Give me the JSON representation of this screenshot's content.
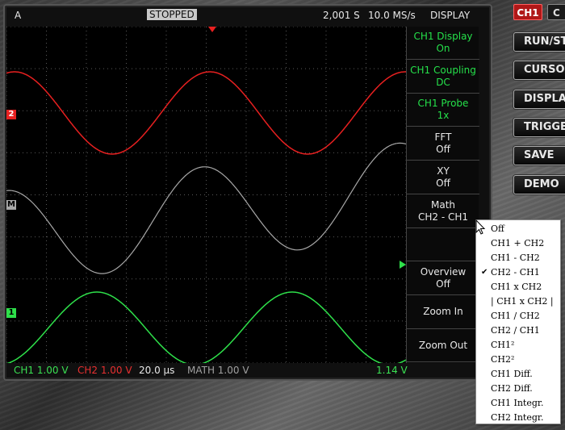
{
  "scope": {
    "mode": "A",
    "status": "STOPPED",
    "samples": "2,001 S",
    "sample_rate": "10.0 MS/s",
    "menu_title": "DISPLAY"
  },
  "side_menu": [
    {
      "line1": "CH1 Display",
      "line2": "On",
      "color": "green"
    },
    {
      "line1": "CH1 Coupling",
      "line2": "DC",
      "color": "green"
    },
    {
      "line1": "CH1 Probe",
      "line2": "1x",
      "color": "green"
    },
    {
      "line1": "FFT",
      "line2": "Off",
      "color": "white"
    },
    {
      "line1": "XY",
      "line2": "Off",
      "color": "white"
    },
    {
      "line1": "Math",
      "line2": "CH2 - CH1",
      "color": "white"
    },
    {
      "line1": "",
      "line2": "",
      "color": "white"
    },
    {
      "line1": "Overview",
      "line2": "Off",
      "color": "white"
    },
    {
      "line1": "Zoom In",
      "line2": "",
      "color": "white"
    },
    {
      "line1": "Zoom Out",
      "line2": "",
      "color": "white"
    }
  ],
  "status": {
    "ch1": "CH1 1.00 V",
    "ch2": "CH2 1.00 V",
    "timebase": "20.0 µs",
    "math": "MATH 1.00 V",
    "trigger": "1.14 V"
  },
  "markers": {
    "ch2": "2",
    "math": "M",
    "ch1": "1"
  },
  "buttons": {
    "ch1": "CH1",
    "ch2": "C",
    "run_stop": "RUN/STO",
    "cursor": "CURSO",
    "display": "DISPLA",
    "trigger": "TRIGGE",
    "save": "SAVE",
    "demo": "DEMO"
  },
  "math_menu": {
    "items": [
      "Off",
      "CH1 + CH2",
      "CH1 - CH2",
      "CH2 - CH1",
      "CH1 x CH2",
      "| CH1 x CH2 |",
      "CH1 / CH2",
      "CH2 / CH1",
      "CH1²",
      "CH2²",
      "CH1 Diff.",
      "CH2 Diff.",
      "CH1 Integr.",
      "CH2 Integr."
    ],
    "selected_index": 3
  },
  "colors": {
    "ch1": "#2ee04a",
    "ch2": "#e82020",
    "math": "#a8a8a8",
    "grid": "#5a5a5a"
  }
}
